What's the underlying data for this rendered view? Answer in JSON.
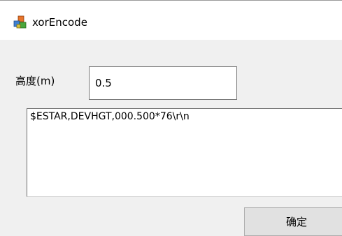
{
  "window": {
    "title": "xorEncode",
    "icon": "colored-blocks-app-icon"
  },
  "form": {
    "height_label": "高度(m)",
    "height_value": "0.5"
  },
  "output": {
    "text": "$ESTAR,DEVHGT,000.500*76\\r\\n"
  },
  "buttons": {
    "ok_label": "确定"
  },
  "colors": {
    "window_background": "#f0f0f0",
    "titlebar_background": "#ffffff",
    "input_background": "#ffffff",
    "button_background": "#e1e1e1",
    "border": "#7a7a7a"
  }
}
